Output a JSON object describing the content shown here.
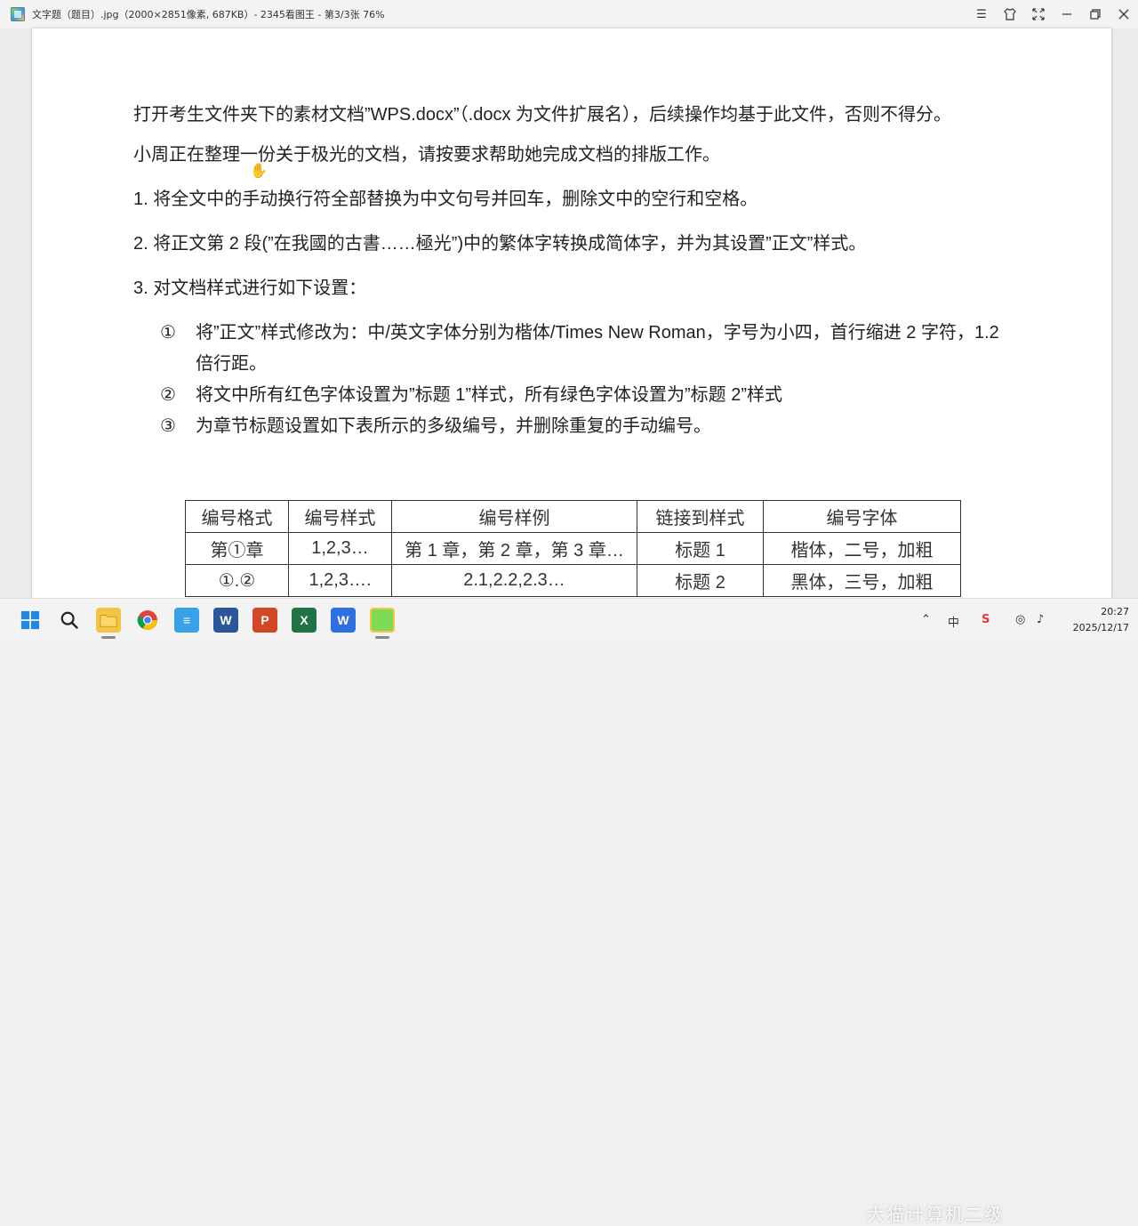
{
  "window": {
    "title": "文字题（题目）.jpg（2000×2851像素, 687KB）- 2345看图王 - 第3/3张 76%",
    "controls": [
      "menu-icon",
      "shirt-icon",
      "fullscreen-icon",
      "minimize-icon",
      "restore-icon",
      "close-icon"
    ]
  },
  "document": {
    "intro": "打开考生文件夹下的素材文档”WPS.docx”（.docx 为文件扩展名），后续操作均基于此文件，否则不得分。",
    "task_intro": "小周正在整理一份关于极光的文档，请按要求帮助她完成文档的排版工作。",
    "steps": [
      "1. 将全文中的手动换行符全部替换为中文句号并回车，删除文中的空行和空格。",
      "2. 将正文第 2 段(”在我國的古書……極光”)中的繁体字转换成简体字，并为其设置”正文”样式。",
      "3. 对文档样式进行如下设置："
    ],
    "substeps": [
      {
        "num": "①",
        "text": "将”正文”样式修改为：中/英文字体分别为楷体/Times New Roman，字号为小四，首行缩进 2 字符，1.2 倍行距。"
      },
      {
        "num": "②",
        "text": "将文中所有红色字体设置为”标题 1”样式，所有绿色字体设置为”标题 2”样式"
      },
      {
        "num": "③",
        "text": "为章节标题设置如下表所示的多级编号，并删除重复的手动编号。"
      }
    ],
    "table": {
      "headers": [
        "编号格式",
        "编号样式",
        "编号样例",
        "链接到样式",
        "编号字体"
      ],
      "rows": [
        [
          "第①章",
          "1,2,3…",
          "第 1 章，第 2 章，第 3 章…",
          "标题 1",
          "楷体，二号，加粗"
        ],
        [
          "①.②",
          "1,2,3….",
          "2.1,2.2,2.3…",
          "标题 2",
          "黑体，三号，加粗"
        ]
      ]
    }
  },
  "taskbar": {
    "apps": [
      "start-icon",
      "search-icon",
      "file-explorer-icon",
      "chrome-icon",
      "notepad-icon",
      "word-icon",
      "powerpoint-icon",
      "excel-icon",
      "wps-icon",
      "image-viewer-icon"
    ],
    "time": "20:27",
    "date": "2025/12/17",
    "watermark": "大猫计算机二级"
  }
}
